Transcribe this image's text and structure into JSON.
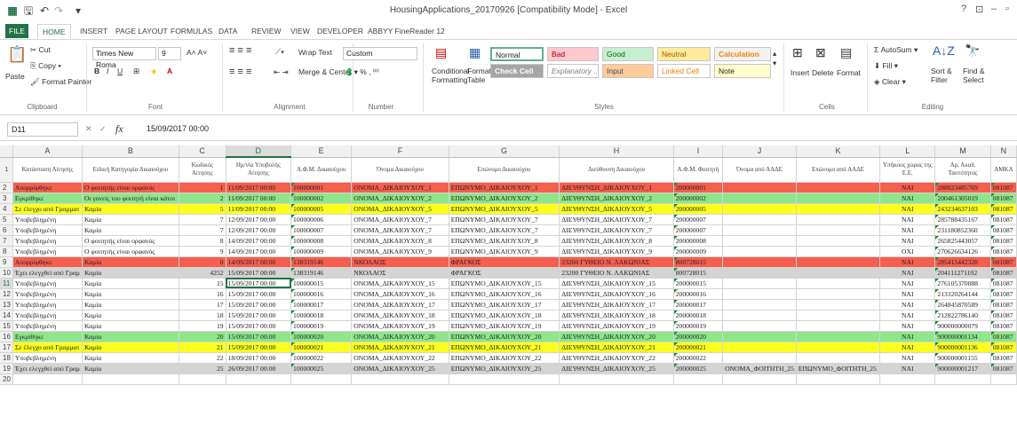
{
  "title": "HousingApplications_20170926 [Compatibility Mode] - Excel",
  "window_controls": [
    "?",
    "⊡",
    "–",
    "▫"
  ],
  "ribbon_tabs": [
    "FILE",
    "HOME",
    "INSERT",
    "PAGE LAYOUT",
    "FORMULAS",
    "DATA",
    "REVIEW",
    "VIEW",
    "DEVELOPER",
    "ABBYY FineReader 12"
  ],
  "clipboard": {
    "paste": "Paste",
    "cut": "Cut",
    "copy": "Copy",
    "format_painter": "Format Painter",
    "label": "Clipboard"
  },
  "font": {
    "name": "Times New Roma",
    "size": "9",
    "label": "Font"
  },
  "alignment": {
    "wrap": "Wrap Text",
    "merge": "Merge & Center",
    "label": "Alignment"
  },
  "number": {
    "format": "Custom",
    "label": "Number"
  },
  "styles": {
    "cond1": "Conditional",
    "cond2": "Formatting",
    "fmt1": "Format as",
    "fmt2": "Table",
    "normal": "Normal",
    "bad": "Bad",
    "good": "Good",
    "neutral": "Neutral",
    "calc": "Calculation",
    "check": "Check Cell",
    "explan": "Explanatory ...",
    "input": "Input",
    "linked": "Linked Cell",
    "note": "Note",
    "label": "Styles"
  },
  "cells": {
    "insert": "Insert",
    "delete": "Delete",
    "format": "Format",
    "label": "Cells"
  },
  "editing": {
    "autosum": "AutoSum",
    "fill": "Fill",
    "clear": "Clear",
    "sort1": "Sort &",
    "sort2": "Filter",
    "find1": "Find &",
    "find2": "Select",
    "label": "Editing"
  },
  "name_box": "D11",
  "formula": "15/09/2017 00:00",
  "fx": "fx",
  "columns": [
    "A",
    "B",
    "C",
    "D",
    "E",
    "F",
    "G",
    "H",
    "I",
    "J",
    "K",
    "L",
    "M",
    "N"
  ],
  "header_row": [
    "Κατάσταση Αίτησης",
    "Ειδική Κατηγορία Δικαιούχου",
    "Κωδικός Αίτησης",
    "Ημ/νία Υποβολής Αίτησης",
    "Α.Φ.Μ. Δικαιούχου",
    "Όνομα Δικαιούχου",
    "Επώνυμο Δικαιούχου",
    "Διεύθυνση Δικαιούχου",
    "Α.Φ.Μ. Φοιτητή",
    "Όνομα από ΑΑΔΕ",
    "Επώνυμο από ΑΑΔΕ",
    "Υπήκοος χώρας της Ε.Ε.",
    "Αρ. Ακαδ. Ταυτότητας",
    "ΑΜΚΑ"
  ],
  "rows": [
    {
      "n": "2",
      "cls": "red",
      "c": [
        "Απορρίφθηκε",
        "Ο φοιτητής είναι ορφανός",
        "1",
        "11/09/2017 00:00",
        "100000001",
        "ΟΝΟΜΑ_ΔΙΚΑΙΟΥΧΟΥ_1",
        "ΕΠΩΝΥΜΟ_ΔΙΚΑΙΟΥΧΟΥ_1",
        "ΔΙΕΥΘΥΝΣΗ_ΔΙΚΑΙΟΥΧΟΥ_1",
        "200000001",
        "",
        "",
        "ΝΑΙ",
        "288023485769",
        "081087"
      ]
    },
    {
      "n": "3",
      "cls": "green",
      "c": [
        "Εγκρίθηκε",
        "Οι γονείς του φοιτητή είναι κάτοι",
        "2",
        "11/09/2017 00:00",
        "100000002",
        "ΟΝΟΜΑ_ΔΙΚΑΙΟΥΧΟΥ_2",
        "ΕΠΩΝΥΜΟ_ΔΙΚΑΙΟΥΧΟΥ_2",
        "ΔΙΕΥΘΥΝΣΗ_ΔΙΚΑΙΟΥΧΟΥ_2",
        "200000002",
        "",
        "",
        "ΝΑΙ",
        "200461305019",
        "081087"
      ]
    },
    {
      "n": "4",
      "cls": "yellow",
      "c": [
        "Σε έλεγχο από Γραμματ",
        "Καμία",
        "5",
        "11/09/2017 00:00",
        "100000005",
        "ΟΝΟΜΑ_ΔΙΚΑΙΟΥΧΟΥ_5",
        "ΕΠΩΝΥΜΟ_ΔΙΚΑΙΟΥΧΟΥ_5",
        "ΔΙΕΥΘΥΝΣΗ_ΔΙΚΑΙΟΥΧΟΥ_5",
        "200000005",
        "",
        "",
        "ΝΑΙ",
        "243234637103",
        "081087"
      ]
    },
    {
      "n": "5",
      "cls": "",
      "c": [
        "Υποβεβλημένη",
        "Καμία",
        "7",
        "12/09/2017 00:00",
        "100000006",
        "ΟΝΟΜΑ_ΔΙΚΑΙΟΥΧΟΥ_7",
        "ΕΠΩΝΥΜΟ_ΔΙΚΑΙΟΥΧΟΥ_7",
        "ΔΙΕΥΘΥΝΣΗ_ΔΙΚΑΙΟΥΧΟΥ_7",
        "200000007",
        "",
        "",
        "ΝΑΙ",
        "285788435167",
        "081087"
      ]
    },
    {
      "n": "6",
      "cls": "",
      "c": [
        "Υποβεβλημένη",
        "Καμία",
        "7",
        "12/09/2017 00:00",
        "100000007",
        "ΟΝΟΜΑ_ΔΙΚΑΙΟΥΧΟΥ_7",
        "ΕΠΩΝΥΜΟ_ΔΙΚΑΙΟΥΧΟΥ_7",
        "ΔΙΕΥΘΥΝΣΗ_ΔΙΚΑΙΟΥΧΟΥ_7",
        "200000007",
        "",
        "",
        "ΝΑΙ",
        "231180852360",
        "081087"
      ]
    },
    {
      "n": "7",
      "cls": "",
      "c": [
        "Υποβεβλημένη",
        "Ο φοιτητής είναι ορφανός",
        "8",
        "14/09/2017 00:00",
        "100000008",
        "ΟΝΟΜΑ_ΔΙΚΑΙΟΥΧΟΥ_8",
        "ΕΠΩΝΥΜΟ_ΔΙΚΑΙΟΥΧΟΥ_8",
        "ΔΙΕΥΘΥΝΣΗ_ΔΙΚΑΙΟΥΧΟΥ_8",
        "200000008",
        "",
        "",
        "ΝΑΙ",
        "265825443057",
        "081087"
      ]
    },
    {
      "n": "8",
      "cls": "",
      "c": [
        "Υποβεβλημένη",
        "Ο φοιτητής είναι ορφανός",
        "9",
        "14/09/2017 00:00",
        "100000009",
        "ΟΝΟΜΑ_ΔΙΚΑΙΟΥΧΟΥ_9",
        "ΕΠΩΝΥΜΟ_ΔΙΚΑΙΟΥΧΟΥ_9",
        "ΔΙΕΥΘΥΝΣΗ_ΔΙΚΑΙΟΥΧΟΥ_9",
        "200000009",
        "",
        "",
        "ΟΧΙ",
        "270626634126",
        "081087"
      ]
    },
    {
      "n": "9",
      "cls": "red",
      "c": [
        "Απορρίφθηκε",
        "Καμία",
        "0",
        "14/09/2017 00:00",
        "138319146",
        "ΝΚΟΛΑΟΣ",
        "ΦΡΑΓΚΟΣ",
        "23200 ΓΥΘΕΙΟ Ν. ΛΑΚΩΝΙΑΣ",
        "800728015",
        "",
        "",
        "ΝΑΙ",
        "285415442328",
        "081087"
      ]
    },
    {
      "n": "10",
      "cls": "gray",
      "c": [
        "Έχει ελεγχθεί από Γραμ",
        "Καμία",
        "4252",
        "15/09/2017 00:00",
        "138319146",
        "ΝΚΟΛΑΟΣ",
        "ΦΡΑΓΚΟΣ",
        "23200 ΓΥΘΕΙΟ Ν. ΛΑΚΩΝΙΑΣ",
        "800728015",
        "",
        "",
        "ΝΑΙ",
        "204111271102",
        "081087"
      ]
    },
    {
      "n": "11",
      "cls": "",
      "c": [
        "Υποβεβλημένη",
        "Καμία",
        "15",
        "15/09/2017 00:00",
        "100000015",
        "ΟΝΟΜΑ_ΔΙΚΑΙΟΥΧΟΥ_15",
        "ΕΠΩΝΥΜΟ_ΔΙΚΑΙΟΥΧΟΥ_15",
        "ΔΙΕΥΘΥΝΣΗ_ΔΙΚΑΙΟΥΧΟΥ_15",
        "200000015",
        "",
        "",
        "ΝΑΙ",
        "276105370088",
        "081087"
      ]
    },
    {
      "n": "12",
      "cls": "",
      "c": [
        "Υποβεβλημένη",
        "Καμία",
        "16",
        "15/09/2017 00:00",
        "100000016",
        "ΟΝΟΜΑ_ΔΙΚΑΙΟΥΧΟΥ_16",
        "ΕΠΩΝΥΜΟ_ΔΙΚΑΙΟΥΧΟΥ_16",
        "ΔΙΕΥΘΥΝΣΗ_ΔΙΚΑΙΟΥΧΟΥ_16",
        "200000016",
        "",
        "",
        "ΝΑΙ",
        "213320264144",
        "081087"
      ]
    },
    {
      "n": "13",
      "cls": "",
      "c": [
        "Υποβεβλημένη",
        "Καμία",
        "17",
        "15/09/2017 00:00",
        "100000017",
        "ΟΝΟΜΑ_ΔΙΚΑΙΟΥΧΟΥ_17",
        "ΕΠΩΝΥΜΟ_ΔΙΚΑΙΟΥΧΟΥ_17",
        "ΔΙΕΥΘΥΝΣΗ_ΔΙΚΑΙΟΥΧΟΥ_17",
        "200000017",
        "",
        "",
        "ΝΑΙ",
        "264845870589",
        "081087"
      ]
    },
    {
      "n": "14",
      "cls": "",
      "c": [
        "Υποβεβλημένη",
        "Καμία",
        "18",
        "15/09/2017 00:00",
        "100000018",
        "ΟΝΟΜΑ_ΔΙΚΑΙΟΥΧΟΥ_18",
        "ΕΠΩΝΥΜΟ_ΔΙΚΑΙΟΥΧΟΥ_18",
        "ΔΙΕΥΘΥΝΣΗ_ΔΙΚΑΙΟΥΧΟΥ_18",
        "200000018",
        "",
        "",
        "ΝΑΙ",
        "212822786140",
        "081087"
      ]
    },
    {
      "n": "15",
      "cls": "",
      "c": [
        "Υποβεβλημένη",
        "Καμία",
        "19",
        "15/09/2017 00:00",
        "100000019",
        "ΟΝΟΜΑ_ΔΙΚΑΙΟΥΧΟΥ_19",
        "ΕΠΩΝΥΜΟ_ΔΙΚΑΙΟΥΧΟΥ_19",
        "ΔΙΕΥΘΥΝΣΗ_ΔΙΚΑΙΟΥΧΟΥ_19",
        "200000019",
        "",
        "",
        "ΝΑΙ",
        "900000000079",
        "081087"
      ]
    },
    {
      "n": "16",
      "cls": "green",
      "c": [
        "Εγκρίθηκε",
        "Καμία",
        "20",
        "15/09/2017 00:00",
        "100000020",
        "ΟΝΟΜΑ_ΔΙΚΑΙΟΥΧΟΥ_20",
        "ΕΠΩΝΥΜΟ_ΔΙΚΑΙΟΥΧΟΥ_20",
        "ΔΙΕΥΘΥΝΣΗ_ΔΙΚΑΙΟΥΧΟΥ_20",
        "200000020",
        "",
        "",
        "ΝΑΙ",
        "900000001134",
        "081087"
      ]
    },
    {
      "n": "17",
      "cls": "yellow",
      "c": [
        "Σε έλεγχο από Γραμματ",
        "Καμία",
        "21",
        "15/09/2017 00:00",
        "100000021",
        "ΟΝΟΜΑ_ΔΙΚΑΙΟΥΧΟΥ_21",
        "ΕΠΩΝΥΜΟ_ΔΙΚΑΙΟΥΧΟΥ_21",
        "ΔΙΕΥΘΥΝΣΗ_ΔΙΚΑΙΟΥΧΟΥ_21",
        "200000021",
        "",
        "",
        "ΝΑΙ",
        "900000001136",
        "081087"
      ]
    },
    {
      "n": "18",
      "cls": "",
      "c": [
        "Υποβεβλημένη",
        "Καμία",
        "22",
        "18/09/2017 00:00",
        "100000022",
        "ΟΝΟΜΑ_ΔΙΚΑΙΟΥΧΟΥ_22",
        "ΕΠΩΝΥΜΟ_ΔΙΚΑΙΟΥΧΟΥ_22",
        "ΔΙΕΥΘΥΝΣΗ_ΔΙΚΑΙΟΥΧΟΥ_22",
        "200000022",
        "",
        "",
        "ΝΑΙ",
        "900000001155",
        "081087"
      ]
    },
    {
      "n": "19",
      "cls": "gray",
      "c": [
        "Έχει ελεγχθεί από Γραμ",
        "Καμία",
        "25",
        "26/09/2017 00:00",
        "100000025",
        "ΟΝΟΜΑ_ΔΙΚΑΙΟΥΧΟΥ_25",
        "ΕΠΩΝΥΜΟ_ΔΙΚΑΙΟΥΧΟΥ_25",
        "ΔΙΕΥΘΥΝΣΗ_ΔΙΚΑΙΟΥΧΟΥ_25",
        "200000025",
        "ΟΝΟΜΑ_ΦΟΙΤΗΤΗ_25",
        "ΕΠΩΝΥΜΟ_ΦΟΙΤΗΤΗ_25",
        "ΝΑΙ",
        "900000001217",
        "081087"
      ]
    }
  ],
  "colors": {
    "accent": "#217346",
    "red": "#f65e4d",
    "green": "#8fe68a",
    "yellow": "#ffff1e",
    "gray": "#d4d4d4"
  }
}
